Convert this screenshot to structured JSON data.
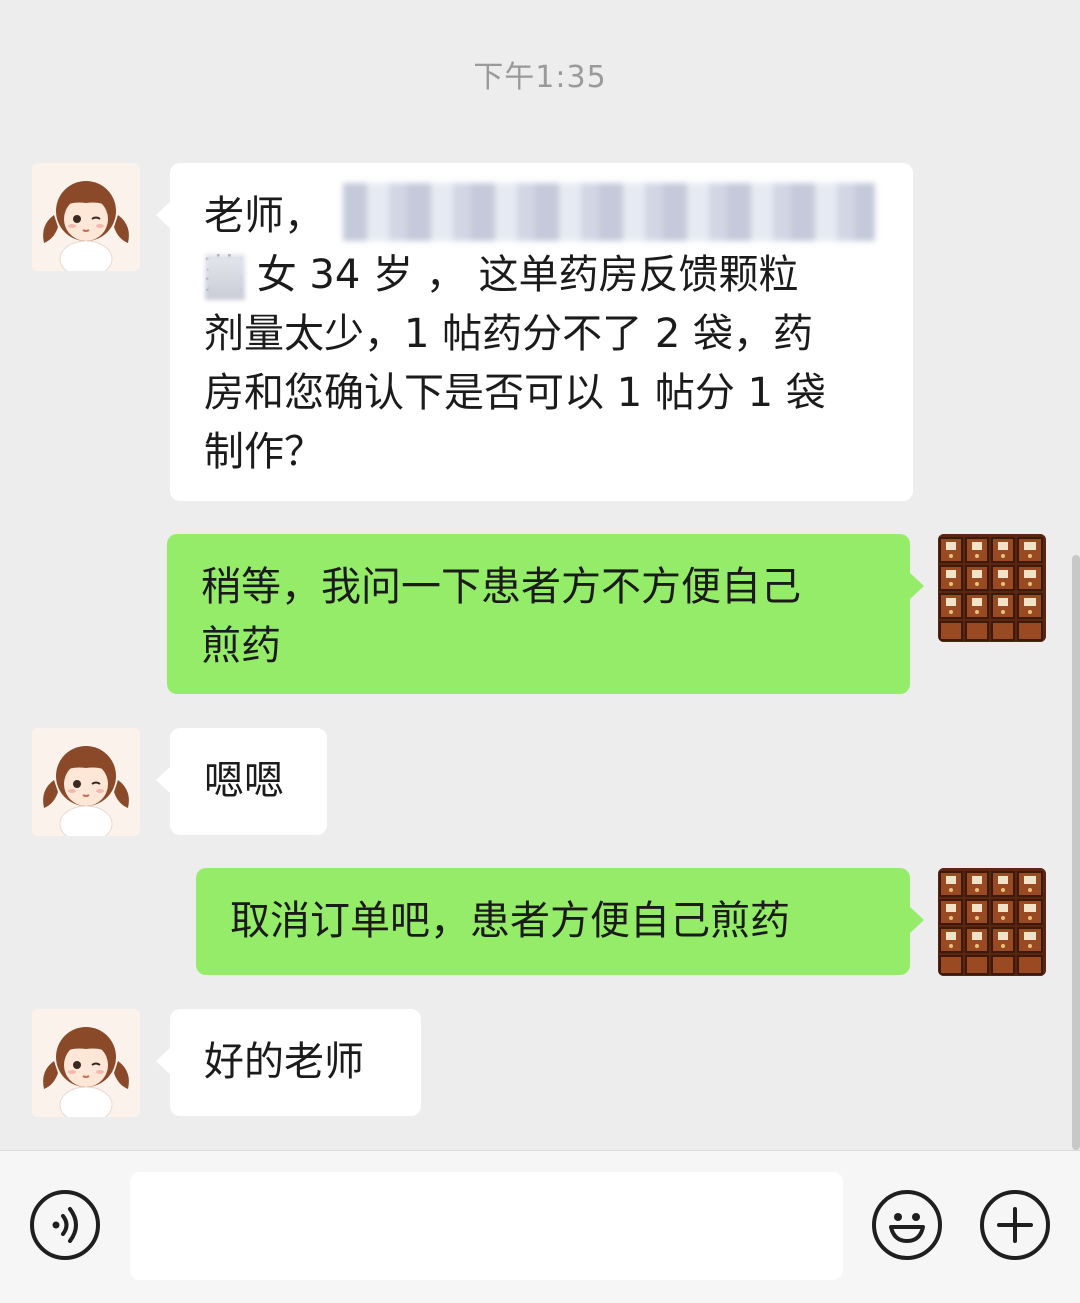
{
  "timestamp": "下午1:35",
  "messages": [
    {
      "side": "left",
      "text_lines": [
        "老师，",
        "燕 女 34 岁 ， 这单药房反馈颗粒",
        "剂量太少，1 帖药分不了 2 袋，药",
        "房和您确认下是否可以 1 帖分 1 袋",
        "制作？"
      ]
    },
    {
      "side": "right",
      "text_lines": [
        "稍等，我问一下患者方不方便自己",
        "煎药"
      ]
    },
    {
      "side": "left",
      "text": "嗯嗯"
    },
    {
      "side": "right",
      "text": "取消订单吧，患者方便自己煎药"
    },
    {
      "side": "left",
      "text": "好的老师"
    }
  ],
  "avatars": {
    "left": "cartoon-girl-avatar",
    "right": "medicine-cabinet-avatar"
  },
  "input_bar": {
    "voice_icon": "voice-icon",
    "input_value": "",
    "emoji_icon": "smiley-icon",
    "more_icon": "plus-icon"
  },
  "colors": {
    "background": "#ededed",
    "incoming_bubble": "#ffffff",
    "outgoing_bubble": "#95ec69"
  }
}
